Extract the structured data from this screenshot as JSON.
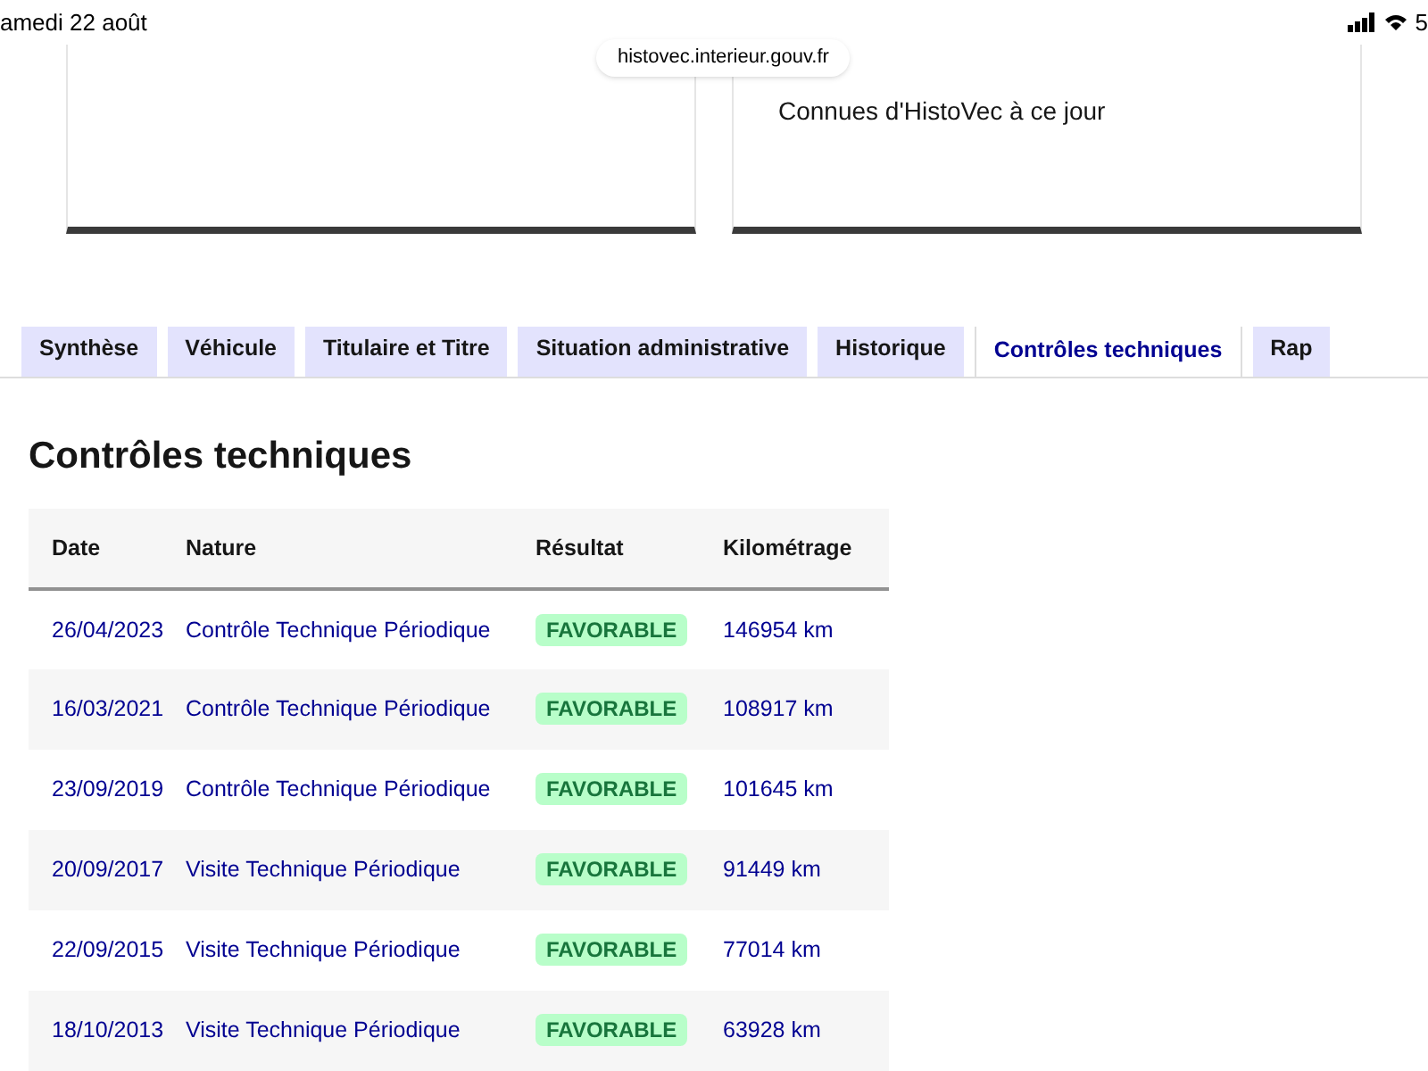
{
  "status_bar": {
    "time": "amedi 22 août",
    "url": "histovec.interieur.gouv.fr",
    "battery": "5"
  },
  "cards": [
    {
      "kind": "blank"
    },
    {
      "kind": "text",
      "text": "Connues d'HistoVec à ce jour"
    }
  ],
  "tabs": [
    {
      "label": "Synthèse",
      "selected": false
    },
    {
      "label": "Véhicule",
      "selected": false
    },
    {
      "label": "Titulaire et Titre",
      "selected": false
    },
    {
      "label": "Situation administrative",
      "selected": false
    },
    {
      "label": "Historique",
      "selected": false
    },
    {
      "label": "Contrôles techniques",
      "selected": true
    },
    {
      "label": "Rap",
      "selected": false
    }
  ],
  "section_title": "Contrôles techniques",
  "table": {
    "columns": [
      "Date",
      "Nature",
      "Résultat",
      "Kilométrage"
    ],
    "rows": [
      {
        "date": "26/04/2023",
        "nature": "Contrôle Technique Périodique",
        "result": "FAVORABLE",
        "km": "146954 km"
      },
      {
        "date": "16/03/2021",
        "nature": "Contrôle Technique Périodique",
        "result": "FAVORABLE",
        "km": "108917 km"
      },
      {
        "date": "23/09/2019",
        "nature": "Contrôle Technique Périodique",
        "result": "FAVORABLE",
        "km": "101645 km"
      },
      {
        "date": "20/09/2017",
        "nature": "Visite Technique Périodique",
        "result": "FAVORABLE",
        "km": "91449 km"
      },
      {
        "date": "22/09/2015",
        "nature": "Visite Technique Périodique",
        "result": "FAVORABLE",
        "km": "77014 km"
      },
      {
        "date": "18/10/2013",
        "nature": "Visite Technique Périodique",
        "result": "FAVORABLE",
        "km": "63928 km"
      }
    ]
  }
}
